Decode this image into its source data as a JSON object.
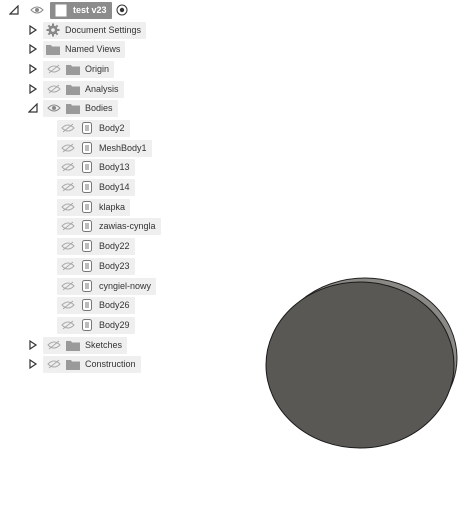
{
  "browser": {
    "root": {
      "label": "test v23",
      "expanded": true
    },
    "folders": [
      {
        "label": "Document Settings",
        "icon": "gear-icon",
        "expanded": false
      },
      {
        "label": "Named Views",
        "icon": "folder-icon",
        "expanded": false
      },
      {
        "label": "Origin",
        "icon": "folder-icon",
        "expanded": false
      },
      {
        "label": "Analysis",
        "icon": "folder-icon",
        "expanded": false
      },
      {
        "label": "Bodies",
        "icon": "folder-icon",
        "expanded": true
      }
    ],
    "bodies": [
      {
        "label": "Body2"
      },
      {
        "label": "MeshBody1"
      },
      {
        "label": "Body13"
      },
      {
        "label": "Body14"
      },
      {
        "label": "klapka"
      },
      {
        "label": "zawias-cyngla"
      },
      {
        "label": "Body22"
      },
      {
        "label": "Body23"
      },
      {
        "label": "cyngiel-nowy"
      },
      {
        "label": "Body26"
      },
      {
        "label": "Body29"
      }
    ],
    "trailing": [
      {
        "label": "Sketches",
        "icon": "folder-icon",
        "expanded": false
      },
      {
        "label": "Construction",
        "icon": "folder-icon",
        "expanded": false
      }
    ]
  },
  "colors": {
    "chip_bg": "#efefef",
    "root_bg": "#8c8c8c",
    "icon_gray": "#9a9a9a",
    "body_fill": "#5a5855"
  }
}
